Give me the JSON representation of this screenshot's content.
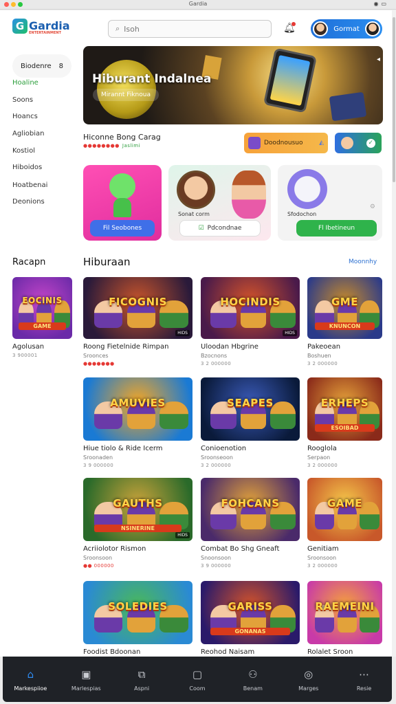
{
  "window": {
    "title": "Gardia",
    "status_icons": [
      "wifi-icon",
      "battery-icon"
    ]
  },
  "header": {
    "logo_text": "Gardia",
    "logo_sub": "ENTERTAINMENT",
    "search_placeholder": "Isoh",
    "profile_name": "Gormat"
  },
  "sidebar": {
    "head_label": "Biodenre",
    "head_count": "8",
    "items": [
      "Hoaline",
      "Soons",
      "Hoancs",
      "Agliobian",
      "Kostiol",
      "Hiboidos",
      "Hoatbenai",
      "Deonions"
    ]
  },
  "hero": {
    "title": "Hiburant Indalnea",
    "button": "Mirannt Fiknoua"
  },
  "featured": {
    "title": "Hiconne Bong Carag",
    "rating": "●●●●●●●●",
    "rating_extra": "Jaslimi",
    "cta_orange": "Doodnousuo",
    "colors": {
      "orange": "#f6a23a",
      "blue": "#2f6fe0"
    }
  },
  "cards": [
    {
      "button": "Fil Seobones"
    },
    {
      "label": "Sonat corm",
      "button": "Pdcondnae"
    },
    {
      "label": "Sfodochon",
      "button": "Fl Ibetineun"
    }
  ],
  "sections": {
    "left_title": "Racapn",
    "main_title": "Hiburaan",
    "more_link": "Moonnhy"
  },
  "games": [
    {
      "thumb_title": "EOCINIS",
      "thumb_sub": "GAME",
      "title": "Agolusan",
      "rating": "3 900001",
      "bg": [
        "#6a2aa8",
        "#c445c8"
      ]
    },
    {
      "thumb_title": "FICOGNIS",
      "thumb_sub": "",
      "tag": "HIDS",
      "title": "Roong Fietelnide Rimpan",
      "sub": "Sroonces",
      "rating": "●●●●●●●",
      "bg": [
        "#2a1a3a",
        "#c7542b"
      ]
    },
    {
      "thumb_title": "HOCINDIS",
      "thumb_sub": "",
      "tag": "HIDS",
      "title": "Uloodan Hbgrine",
      "sub": "Bzocnons",
      "rating": "3 2 000000",
      "bg": [
        "#4a1a4a",
        "#d4532a"
      ]
    },
    {
      "thumb_title": "GME",
      "thumb_sub": "KNUNCON",
      "title": "Pakeoean",
      "sub": "Boshuen",
      "rating": "3 2 000000",
      "bg": [
        "#2a3a8a",
        "#c78a2a"
      ]
    },
    {
      "thumb_title": "AMUVIES",
      "thumb_sub": "",
      "title": "Hiue tiolo & Ride Icerm",
      "sub": "Sroonaden",
      "rating": "3 9 000000",
      "bg": [
        "#1a7ad4",
        "#f5a623"
      ]
    },
    {
      "thumb_title": "SEAPES",
      "thumb_sub": "",
      "title": "Conioenotion",
      "sub": "Sroonseoon",
      "rating": "3 2 000000",
      "bg": [
        "#0a1a3a",
        "#3a5ab8"
      ]
    },
    {
      "thumb_title": "ERHEPS",
      "thumb_sub": "ESOIBAD",
      "title": "Rooglola",
      "sub": "Serpaon",
      "rating": "3 2 000000",
      "bg": [
        "#8a2a1a",
        "#e5a23a"
      ]
    },
    {
      "thumb_title": "GAUTHS",
      "thumb_sub": "NSINERINE",
      "tag": "HIDS",
      "title": "Acriiolotor Rismon",
      "sub": "Sroonsoon",
      "rating": "●● 000000",
      "bg": [
        "#2a6a2a",
        "#c8a23a"
      ]
    },
    {
      "thumb_title": "FOHCANS",
      "thumb_sub": "",
      "title": "Combat Bo Shg Gneaft",
      "sub": "Snoonsoon",
      "rating": "3 9 000000",
      "bg": [
        "#4a2a6a",
        "#e2a23a"
      ]
    },
    {
      "thumb_title": "GAME",
      "thumb_sub": "",
      "title": "Genitiam",
      "sub": "Sroonsoon",
      "rating": "3 2 000000",
      "bg": [
        "#c8582a",
        "#f5c84a"
      ]
    },
    {
      "thumb_title": "SOLEDIES",
      "thumb_sub": "",
      "title": "Foodist Bdoonan",
      "bg": [
        "#2a8ad4",
        "#4ab85a"
      ]
    },
    {
      "thumb_title": "GARISS",
      "thumb_sub": "GONANAS",
      "title": "Reohod Naisam",
      "bg": [
        "#2a1a6a",
        "#d4532a"
      ]
    },
    {
      "thumb_title": "RAEMEINI",
      "thumb_sub": "",
      "title": "Rolalet Sroon",
      "bg": [
        "#c83aa8",
        "#f5a23a"
      ]
    }
  ],
  "tabbar": {
    "items": [
      {
        "label": "Markespiioe",
        "icon": "home-icon",
        "active": true
      },
      {
        "label": "Marlespias",
        "icon": "bag-icon"
      },
      {
        "label": "Aspni",
        "icon": "puzzle-icon"
      },
      {
        "label": "Coom",
        "icon": "square-icon"
      },
      {
        "label": "Benam",
        "icon": "users-icon"
      },
      {
        "label": "Marges",
        "icon": "circle-icon"
      },
      {
        "label": "Resie",
        "icon": "more-icon"
      }
    ],
    "accent": "#2f8df5"
  }
}
